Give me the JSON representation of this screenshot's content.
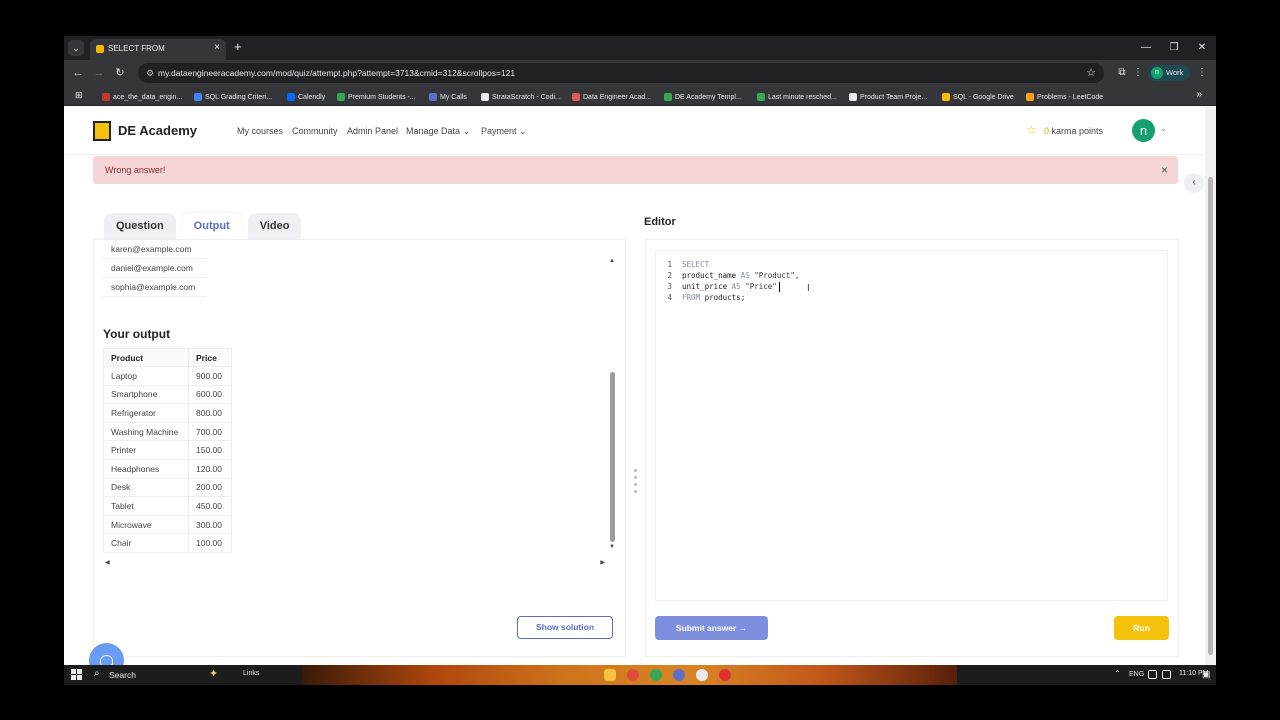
{
  "browser": {
    "tab_title": "SELECT FROM",
    "url": "my.dataengineeracademy.com/mod/quiz/attempt.php?attempt=3713&cmid=312&scrollpos=121",
    "profile_label": "Work",
    "profile_initial": "n",
    "bookmarks": [
      {
        "label": "ace_the_data_engin...",
        "color": "#c0392b"
      },
      {
        "label": "SQL Grading Criteri...",
        "color": "#4285f4"
      },
      {
        "label": "Calendly",
        "color": "#006bff"
      },
      {
        "label": "Premium Students -...",
        "color": "#34a853"
      },
      {
        "label": "My Calls",
        "color": "#5b6ec9"
      },
      {
        "label": "StrataScratch - Codi...",
        "color": "#e8eaed"
      },
      {
        "label": "Data Engineer Acad...",
        "color": "#e05a5a"
      },
      {
        "label": "DE Academy Templ...",
        "color": "#34a853"
      },
      {
        "label": "Last minute resched...",
        "color": "#34a853"
      },
      {
        "label": "Product Team Proje...",
        "color": "#e8eaed"
      },
      {
        "label": "SQL - Google Drive",
        "color": "#fbbc04"
      },
      {
        "label": "Problems - LeetCode",
        "color": "#ffa116"
      }
    ]
  },
  "site": {
    "brand": "DE Academy",
    "nav": [
      "My courses",
      "Community",
      "Admin Panel",
      "Manage Data",
      "Payment"
    ],
    "karma_count": "0",
    "karma_label": "karma points",
    "avatar_initial": "n"
  },
  "alert": {
    "message": "Wrong answer!"
  },
  "tabs": [
    "Question",
    "Output",
    "Video"
  ],
  "output": {
    "emails": [
      "karen@example.com",
      "daniel@example.com",
      "sophia@example.com"
    ],
    "heading": "Your output",
    "columns": [
      "Product",
      "Price"
    ],
    "rows": [
      [
        "Laptop",
        "900.00"
      ],
      [
        "Smartphone",
        "600.00"
      ],
      [
        "Refrigerator",
        "800.00"
      ],
      [
        "Washing Machine",
        "700.00"
      ],
      [
        "Printer",
        "150.00"
      ],
      [
        "Headphones",
        "120.00"
      ],
      [
        "Desk",
        "200.00"
      ],
      [
        "Tablet",
        "450.00"
      ],
      [
        "Microwave",
        "300.00"
      ],
      [
        "Chair",
        "100.00"
      ]
    ],
    "show_solution_label": "Show solution"
  },
  "editor": {
    "title": "Editor",
    "lines": [
      {
        "num": "1",
        "parts": [
          [
            "kw",
            "SELECT"
          ]
        ]
      },
      {
        "num": "2",
        "parts": [
          [
            "plain",
            "product_name "
          ],
          [
            "kw",
            "AS "
          ],
          [
            "str",
            "\"Product\","
          ]
        ]
      },
      {
        "num": "3",
        "parts": [
          [
            "plain",
            "unit_price "
          ],
          [
            "kw",
            "AS "
          ],
          [
            "str",
            "\"Price\""
          ]
        ]
      },
      {
        "num": "4",
        "parts": [
          [
            "kw",
            "FROM "
          ],
          [
            "plain",
            "products;"
          ]
        ]
      }
    ],
    "submit_label": "Submit answer →",
    "run_label": "Run"
  },
  "taskbar": {
    "search_label": "Search",
    "links_label": "Links",
    "language": "ENG",
    "time": "11:10 PM"
  }
}
